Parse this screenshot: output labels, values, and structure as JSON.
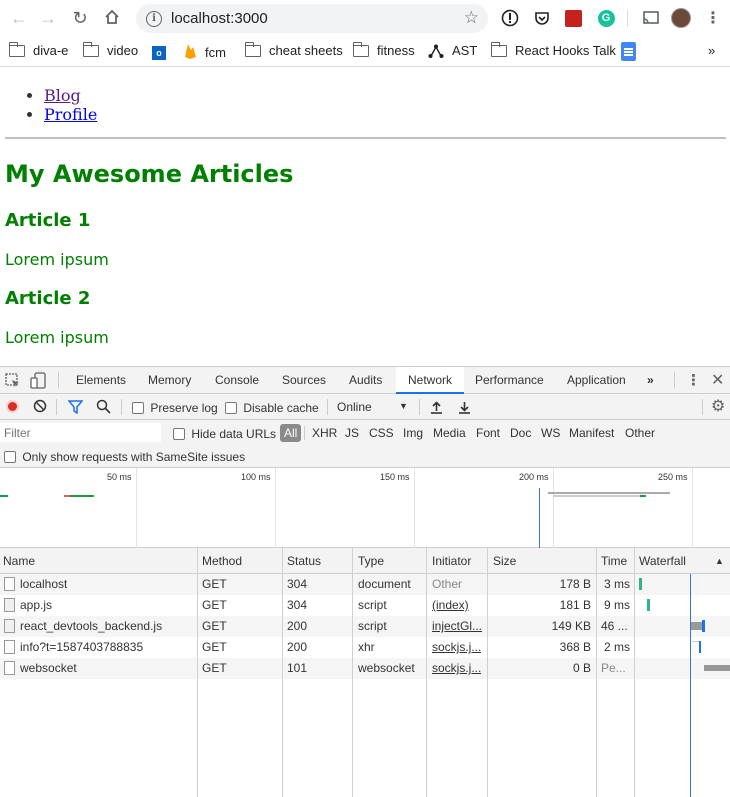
{
  "browser": {
    "url": "localhost:3000",
    "bookmarks": [
      "diva-e",
      "video",
      "fcm",
      "cheat sheets",
      "fitness",
      "AST",
      "React Hooks Talk"
    ],
    "more": "»"
  },
  "page": {
    "nav": [
      "Blog",
      "Profile"
    ],
    "title": "My Awesome Articles",
    "articles": [
      {
        "title": "Article 1",
        "body": "Lorem ipsum"
      },
      {
        "title": "Article 2",
        "body": "Lorem ipsum"
      }
    ]
  },
  "devtools": {
    "tabs": [
      "Elements",
      "Memory",
      "Console",
      "Sources",
      "Audits",
      "Network",
      "Performance",
      "Application",
      "»"
    ],
    "active_tab": "Network",
    "toolbar": {
      "preserve_log": "Preserve log",
      "disable_cache": "Disable cache",
      "throttle": "Online"
    },
    "filter": {
      "placeholder": "Filter",
      "hide_data_urls": "Hide data URLs",
      "types": [
        "All",
        "XHR",
        "JS",
        "CSS",
        "Img",
        "Media",
        "Font",
        "Doc",
        "WS",
        "Manifest",
        "Other"
      ],
      "samesite": "Only show requests with SameSite issues"
    },
    "overview_ticks": [
      "50 ms",
      "100 ms",
      "150 ms",
      "200 ms",
      "250 ms"
    ],
    "columns": [
      "Name",
      "Method",
      "Status",
      "Type",
      "Initiator",
      "Size",
      "Time",
      "Waterfall"
    ],
    "sort_indicator": "▲",
    "requests": [
      {
        "name": "localhost",
        "method": "GET",
        "status": "304",
        "type": "document",
        "initiator": "Other",
        "size": "178 B",
        "time": "3 ms"
      },
      {
        "name": "app.js",
        "method": "GET",
        "status": "304",
        "type": "script",
        "initiator": "(index)",
        "size": "181 B",
        "time": "9 ms"
      },
      {
        "name": "react_devtools_backend.js",
        "method": "GET",
        "status": "200",
        "type": "script",
        "initiator": "injectGl...",
        "size": "149 KB",
        "time": "46 ..."
      },
      {
        "name": "info?t=1587403788835",
        "method": "GET",
        "status": "200",
        "type": "xhr",
        "initiator": "sockjs.j...",
        "size": "368 B",
        "time": "2 ms"
      },
      {
        "name": "websocket",
        "method": "GET",
        "status": "101",
        "type": "websocket",
        "initiator": "sockjs.j...",
        "size": "0 B",
        "time": "Pe..."
      }
    ]
  }
}
